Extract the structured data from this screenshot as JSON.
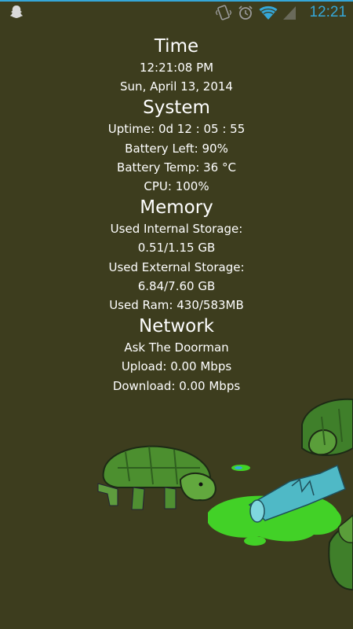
{
  "status_bar": {
    "clock": "12:21",
    "icons": [
      "snapchat-ghost-icon",
      "vibrate-icon",
      "alarm-icon",
      "wifi-icon",
      "signal-icon"
    ]
  },
  "time": {
    "heading": "Time",
    "clock": "12:21:08 PM",
    "date": "Sun, April 13, 2014"
  },
  "system": {
    "heading": "System",
    "uptime": "Uptime: 0d 12 : 05 : 55",
    "battery_left": "Battery Left: 90%",
    "battery_temp": "Battery Temp: 36 °C",
    "cpu": "CPU: 100%"
  },
  "memory": {
    "heading": "Memory",
    "internal_label": "Used Internal Storage:",
    "internal_value": "0.51/1.15 GB",
    "external_label": "Used External Storage:",
    "external_value": "6.84/7.60 GB",
    "ram": "Used Ram: 430/583MB"
  },
  "network": {
    "heading": "Network",
    "ssid": "Ask The Doorman",
    "upload": "Upload: 0.00 Mbps",
    "download": "Download: 0.00 Mbps"
  },
  "colors": {
    "background": "#3d3d1e",
    "accent": "#35a7d8",
    "text": "#ffffff"
  }
}
